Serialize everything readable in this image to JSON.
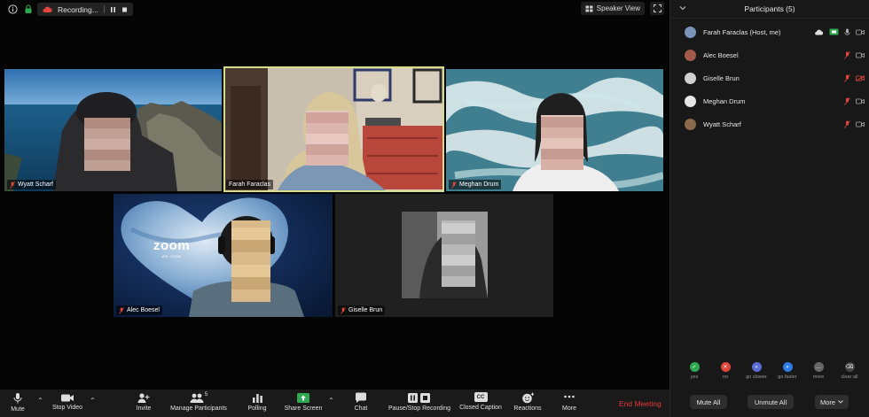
{
  "recording": {
    "label": "Recording..."
  },
  "view": {
    "speaker_view_label": "Speaker View"
  },
  "tiles": {
    "wyatt": {
      "name": "Wyatt Scharf"
    },
    "farah": {
      "name": "Farah Faraclas"
    },
    "meghan": {
      "name": "Meghan Drum"
    },
    "alec": {
      "name": "Alec Boesel"
    },
    "giselle": {
      "name": "Giselle Brun"
    }
  },
  "zoom_background": {
    "logo": "zoom",
    "tagline": "WE CARE"
  },
  "toolbar": {
    "mute": "Mute",
    "stop_video": "Stop Video",
    "invite": "Invite",
    "manage_participants": "Manage Participants",
    "participant_count": "5",
    "polling": "Polling",
    "share_screen": "Share Screen",
    "chat": "Chat",
    "pause_stop_recording": "Pause/Stop Recording",
    "closed_caption": "Closed Caption",
    "closed_caption_icon_text": "CC",
    "reactions": "Reactions",
    "more": "More",
    "end_meeting": "End Meeting"
  },
  "panel": {
    "title": "Participants (5)",
    "participants": [
      {
        "name": "Farah Faraclas (Host, me)"
      },
      {
        "name": "Alec Boesel"
      },
      {
        "name": "Giselle Brun"
      },
      {
        "name": "Meghan Drum"
      },
      {
        "name": "Wyatt Scharf"
      }
    ],
    "feedback": [
      {
        "label": "yes",
        "color": "#2fa84f"
      },
      {
        "label": "no",
        "color": "#e0463c"
      },
      {
        "label": "go slower",
        "color": "#5a6bd1"
      },
      {
        "label": "go faster",
        "color": "#2d7be5"
      },
      {
        "label": "more",
        "color": "#666666"
      },
      {
        "label": "clear all",
        "color": "#444444"
      }
    ],
    "mute_all": "Mute All",
    "unmute_all": "Unmute All",
    "more": "More"
  },
  "colors": {
    "end_meeting": "#e53935",
    "active_speaker_border": "#d7dd8a",
    "muted_red": "#e0463c",
    "share_green": "#2fa84f"
  }
}
